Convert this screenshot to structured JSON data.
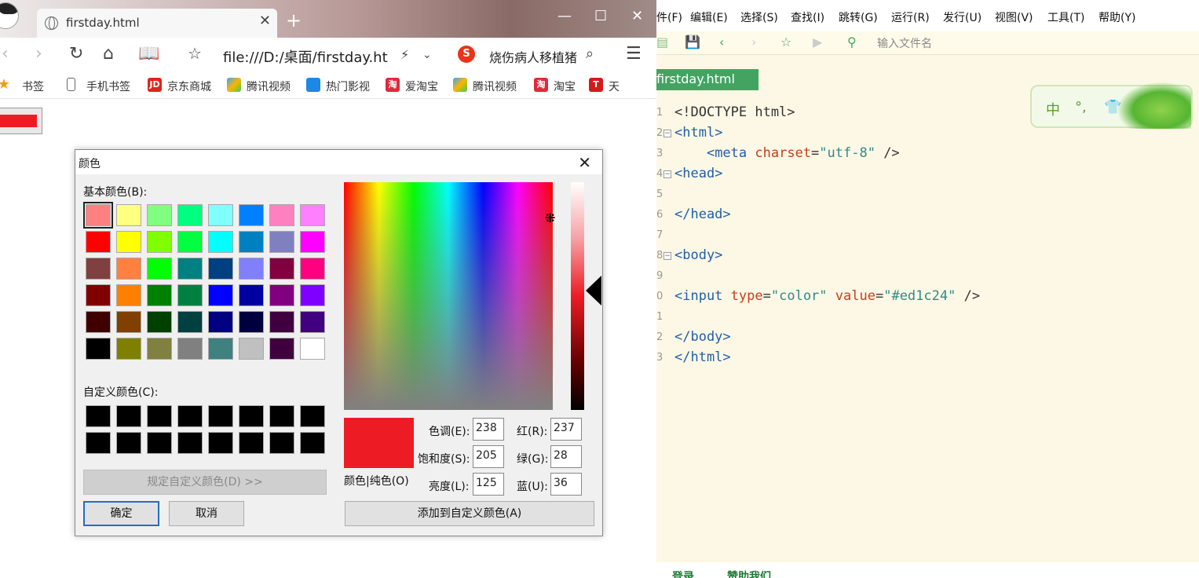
{
  "browser": {
    "tab_title": "firstday.html",
    "url": "file:///D:/桌面/firstday.ht",
    "search_text": "烧伤病人移植猪",
    "search_badge": "S",
    "bookmarks": [
      "书签",
      "手机书签",
      "京东商城",
      "腾讯视频",
      "热门影视",
      "爱淘宝",
      "腾讯视频",
      "淘宝",
      "天"
    ],
    "bookmark_badges": [
      "JD",
      "淘",
      "淘",
      "T"
    ],
    "colors": {
      "accent": "#ed1c24"
    }
  },
  "dialog": {
    "title": "颜色",
    "basic_colors_label": "基本颜色(B):",
    "basic_colors": [
      [
        "#ff8080",
        "#ffff80",
        "#80ff80",
        "#00ff80",
        "#80ffff",
        "#0080ff",
        "#ff80c0",
        "#ff80ff"
      ],
      [
        "#ff0000",
        "#ffff00",
        "#80ff00",
        "#00ff40",
        "#00ffff",
        "#0080c0",
        "#8080c0",
        "#ff00ff"
      ],
      [
        "#804040",
        "#ff8040",
        "#00ff00",
        "#008080",
        "#004080",
        "#8080ff",
        "#800040",
        "#ff0080"
      ],
      [
        "#800000",
        "#ff8000",
        "#008000",
        "#008040",
        "#0000ff",
        "#0000a0",
        "#800080",
        "#8000ff"
      ],
      [
        "#400000",
        "#804000",
        "#004000",
        "#004040",
        "#000080",
        "#000040",
        "#400040",
        "#400080"
      ],
      [
        "#000000",
        "#808000",
        "#808040",
        "#808080",
        "#408080",
        "#c0c0c0",
        "#400040",
        "#ffffff"
      ]
    ],
    "custom_colors_label": "自定义颜色(C):",
    "custom_colors": [
      [
        "#000000",
        "#000000",
        "#000000",
        "#000000",
        "#000000",
        "#000000",
        "#000000",
        "#000000"
      ],
      [
        "#000000",
        "#000000",
        "#000000",
        "#000000",
        "#000000",
        "#000000",
        "#000000",
        "#000000"
      ]
    ],
    "define_button": "规定自定义颜色(D) >>",
    "ok_button": "确定",
    "cancel_button": "取消",
    "preview_label": "颜色|纯色(O)",
    "hue_label": "色调(E):",
    "hue_value": "238",
    "sat_label": "饱和度(S):",
    "sat_value": "205",
    "lum_label": "亮度(L):",
    "lum_value": "125",
    "red_label": "红(R):",
    "red_value": "237",
    "green_label": "绿(G):",
    "green_value": "28",
    "blue_label": "蓝(U):",
    "blue_value": "36",
    "add_custom_button": "添加到自定义颜色(A)",
    "selected_color": "#ed1c24"
  },
  "editor": {
    "menu": [
      "件(F)",
      "编辑(E)",
      "选择(S)",
      "查找(I)",
      "跳转(G)",
      "运行(R)",
      "发行(U)",
      "视图(V)",
      "工具(T)",
      "帮助(Y)"
    ],
    "file_input_placeholder": "输入文件名",
    "file_tab": "firstday.html",
    "line_numbers": [
      "1",
      "2",
      "3",
      "4",
      "5",
      "6",
      "7",
      "8",
      "9",
      "0",
      "1",
      "2",
      "3"
    ],
    "ime": [
      "中",
      "°,",
      "👕"
    ],
    "code": {
      "l1": "<!DOCTYPE html>",
      "html_open": "<html>",
      "meta_tag": "<meta",
      "meta_attr": "charset",
      "meta_val": "\"utf-8\"",
      "meta_end": " />",
      "head_open": "<head>",
      "head_close": "</head>",
      "body_open": "<body>",
      "input_tag": "<input",
      "type_attr": "type",
      "type_val": "\"color\"",
      "value_attr": "value",
      "value_val": "\"#ed1c24\"",
      "input_end": " />",
      "body_close": "</body>",
      "html_close": "</html>"
    },
    "bottom": [
      "登录",
      "赞助我们"
    ]
  }
}
